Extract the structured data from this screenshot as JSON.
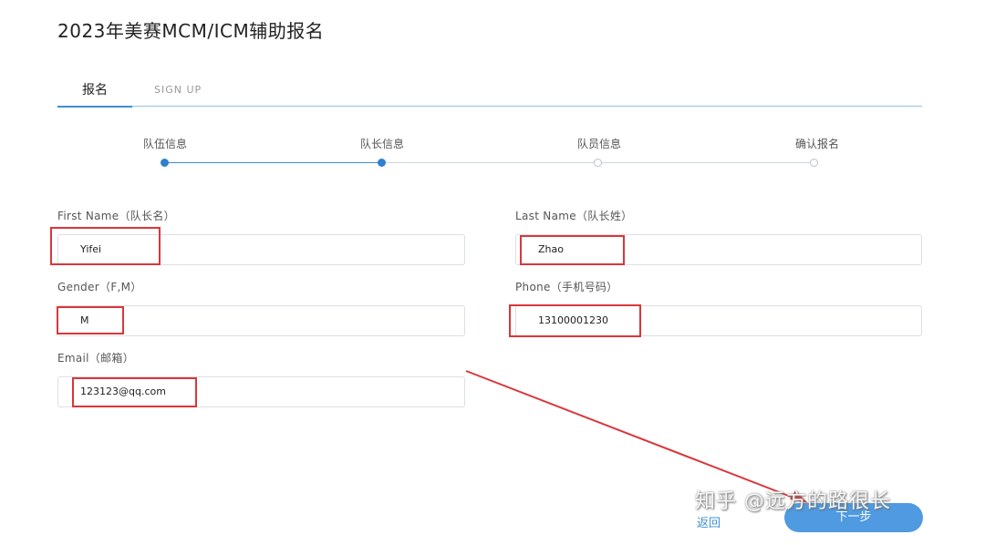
{
  "page": {
    "title": "2023年美赛MCM/ICM辅助报名"
  },
  "tabs": [
    {
      "label": "报名",
      "active": true
    },
    {
      "label": "SIGN UP",
      "active": false
    }
  ],
  "steps": [
    {
      "label": "队伍信息",
      "status": "done"
    },
    {
      "label": "队长信息",
      "status": "done"
    },
    {
      "label": "队员信息",
      "status": "todo"
    },
    {
      "label": "确认报名",
      "status": "todo"
    }
  ],
  "form": {
    "first_name": {
      "label": "First Name（队长名）",
      "value": "Yifei"
    },
    "last_name": {
      "label": "Last Name（队长姓）",
      "value": "Zhao"
    },
    "gender": {
      "label": "Gender（F,M）",
      "value": "M"
    },
    "phone": {
      "label": "Phone（手机号码）",
      "value": "13100001230"
    },
    "email": {
      "label": "Email（邮箱）",
      "value": "123123@qq.com"
    }
  },
  "actions": {
    "back_label": "返回",
    "next_label": "下一步"
  },
  "watermark": "知乎 @远方的路很长",
  "colors": {
    "accent": "#3d8fd6",
    "highlight": "#d9373b",
    "button": "#4f9ae0"
  }
}
